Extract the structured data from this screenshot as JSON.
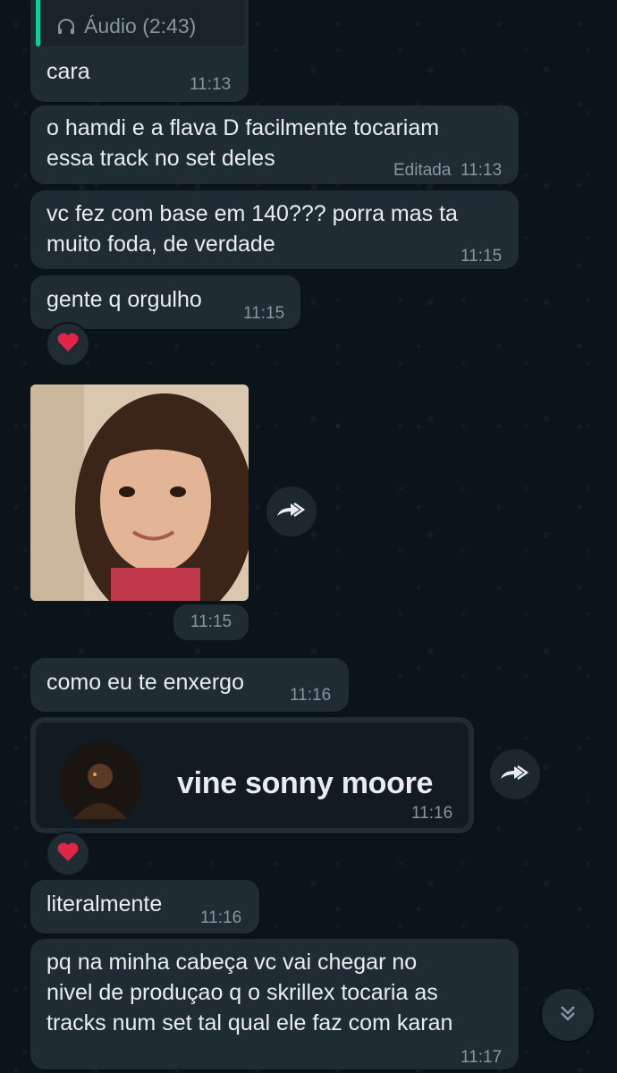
{
  "colors": {
    "background": "#0b141a",
    "bubble_incoming": "#202c33",
    "text_primary": "#e9edef",
    "text_secondary": "#8696a0",
    "quote_accent": "#06cf9c",
    "heart": "#e0244a"
  },
  "messages": {
    "m1": {
      "quote_icon": "headphones-icon",
      "quote_text": "Áudio (2:43)",
      "text": "cara",
      "time": "11:13"
    },
    "m2": {
      "text_line1": "o hamdi e a flava D facilmente tocariam",
      "text_line2": "essa track no set deles",
      "edited": "Editada",
      "time": "11:13"
    },
    "m3": {
      "text_line1": "vc fez com base em 140??? porra mas ta",
      "text_line2": "muito foda, de verdade",
      "time": "11:15"
    },
    "m4": {
      "text": "gente q orgulho",
      "time": "11:15",
      "reaction": "heart-icon"
    },
    "m5": {
      "image": "child-photo",
      "time": "11:15",
      "forward_icon": "forward-icon"
    },
    "m6": {
      "text": "como eu te enxergo",
      "time": "11:16"
    },
    "m7": {
      "link_title": "vine sonny moore",
      "time": "11:16",
      "reaction": "heart-icon",
      "forward_icon": "forward-icon"
    },
    "m8": {
      "text": "literalmente",
      "time": "11:16"
    },
    "m9": {
      "text_line1": "pq na minha cabeça vc vai chegar no",
      "text_line2": "nivel de produçao q o skrillex tocaria as",
      "text_line3": "tracks num set tal qual ele faz com karan",
      "time": "11:17"
    }
  },
  "scroll_down_icon": "double-chevron-down-icon"
}
